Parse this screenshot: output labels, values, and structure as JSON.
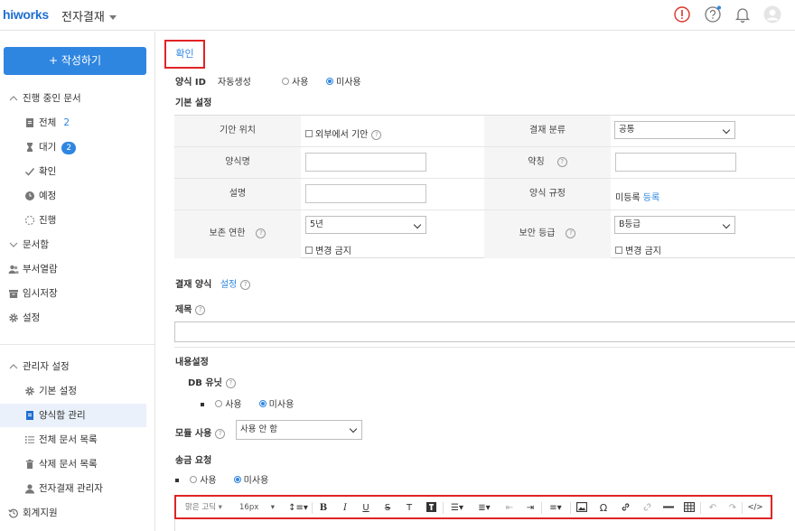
{
  "header": {
    "logo": "hiworks",
    "app_title": "전자결재"
  },
  "sidebar": {
    "compose_label": "+ 작성하기",
    "in_progress_title": "진행 중인 문서",
    "items": [
      {
        "label": "전체",
        "count": "2"
      },
      {
        "label": "대기",
        "count": "2"
      },
      {
        "label": "확인"
      },
      {
        "label": "예정"
      },
      {
        "label": "진행"
      }
    ],
    "doc_box": "문서함",
    "dept_view": "부서열람",
    "temp_save": "임시저장",
    "settings": "설정",
    "admin_title": "관리자 설정",
    "admin_items": [
      {
        "label": "기본 설정"
      },
      {
        "label": "양식함 관리"
      },
      {
        "label": "전체 문서 목록"
      },
      {
        "label": "삭제 문서 목록"
      },
      {
        "label": "전자결재 관리자"
      }
    ],
    "accounting": "회계지원"
  },
  "main": {
    "confirm_label": "확인",
    "form_id_label": "양식 ID",
    "auto_gen_label": "자동생성",
    "use_label": "사용",
    "not_use_label": "미사용",
    "basic_settings": "기본 설정",
    "fields": {
      "draft_location": "기안 위치",
      "external_draft": "외부에서 기안",
      "approval_category": "결재 분류",
      "approval_category_value": "공통",
      "form_name": "양식명",
      "abbreviation": "약칭",
      "description": "설명",
      "form_rules": "양식 규정",
      "unregistered": "미등록",
      "register": "등록",
      "retention": "보존 연한",
      "retention_value": "5년",
      "no_change": "변경 금지",
      "security_level": "보안 등급",
      "security_value": "B등급"
    },
    "approval_form": "결재 양식",
    "setting_link": "설정",
    "subject": "제목",
    "content_settings": "내용설정",
    "db_unit": "DB 유닛",
    "module_use": "모듈 사용",
    "module_value": "사용 안 함",
    "send_request": "송금 요청"
  },
  "toolbar": {
    "font": "맑은 고딕",
    "size": "16px",
    "code": "</>"
  },
  "colors": {
    "accent": "#2f86e0",
    "highlight_border": "#e02424"
  }
}
